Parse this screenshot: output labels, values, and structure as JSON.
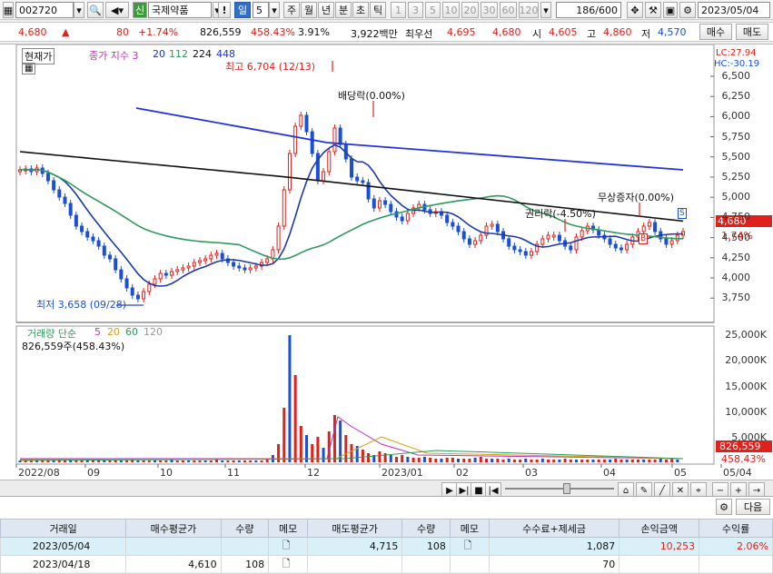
{
  "toolbar": {
    "code": "002720",
    "market_badge": "신",
    "name": "국제약품",
    "period_selected": "일",
    "period_value": "5",
    "periods": [
      "주",
      "월",
      "년",
      "분",
      "초",
      "틱"
    ],
    "intervals": [
      "1",
      "3",
      "5",
      "10",
      "20",
      "30",
      "60",
      "120"
    ],
    "count": "186/600",
    "date": "2023/05/04"
  },
  "quote": {
    "price": "4,680",
    "change": "80",
    "change_pct": "+1.74%",
    "volume": "826,559",
    "volume_ratio": "458.43%",
    "turnover": "3.91%",
    "amount": "3,922백만",
    "best_label": "최우선",
    "ask": "4,695",
    "bid": "4,680",
    "open_label": "시",
    "open": "4,605",
    "high_label": "고",
    "high": "4,860",
    "low_label": "저",
    "low": "4,570",
    "buy_btn": "매수",
    "sell_btn": "매도"
  },
  "price_legend": {
    "current_label": "현재가",
    "ma_label": "종가 지수 3",
    "ma_periods": [
      "20",
      "112",
      "224",
      "448"
    ],
    "lc": "LC:27.94",
    "hc": "HC:-30.19",
    "current_price_tag": "4,680",
    "current_pct_tag": "1.74%"
  },
  "annotations": {
    "high": "최고 6,704 (12/13)",
    "low": "최저 3,658 (09/28)",
    "dividend": "배당락(0.00%)",
    "rights": "권리락(-4.50%)",
    "bonus": "무상증자(0.00%)",
    "marker_b": "B",
    "marker_s": "S"
  },
  "price_axis": [
    "6,500",
    "6,250",
    "6,000",
    "5,750",
    "5,500",
    "5,250",
    "5,000",
    "4,750",
    "4,500",
    "4,250",
    "4,000",
    "3,750"
  ],
  "volume_legend": {
    "label": "거래량 단순",
    "periods": [
      "5",
      "20",
      "60",
      "120"
    ],
    "current": "826,559주(458.43%)",
    "tag_volume": "826,559",
    "tag_pct": "458.43%"
  },
  "volume_axis": [
    "25,000K",
    "20,000K",
    "15,000K",
    "10,000K",
    "5,000K"
  ],
  "x_axis": [
    "2022/08",
    "09",
    "10",
    "11",
    "12",
    "2023/01",
    "02",
    "03",
    "04",
    "05",
    "05/04"
  ],
  "colors": {
    "up": "#e0201a",
    "down": "#1a4fd6",
    "ma20": "#1c3aa8",
    "ma112": "#2e9a5e",
    "ma224": "#111111",
    "ma448": "#2233dd",
    "accent": "#2f6fc9"
  },
  "trade_panel": {
    "next_btn": "다음",
    "columns": [
      "거래일",
      "매수평균가",
      "수량",
      "메모",
      "매도평균가",
      "수량",
      "메모",
      "수수료+제세금",
      "손익금액",
      "수익률"
    ],
    "rows": [
      {
        "date": "2023/05/04",
        "buy_avg": "",
        "buy_qty": "",
        "memo1": "",
        "sell_avg": "4,715",
        "sell_qty": "108",
        "memo2": "",
        "fee": "1,087",
        "pnl": "10,253",
        "ret": "2.06%"
      },
      {
        "date": "2023/04/18",
        "buy_avg": "4,610",
        "buy_qty": "108",
        "memo1": "",
        "sell_avg": "",
        "sell_qty": "",
        "memo2": "",
        "fee": "70",
        "pnl": "",
        "ret": ""
      }
    ]
  }
}
